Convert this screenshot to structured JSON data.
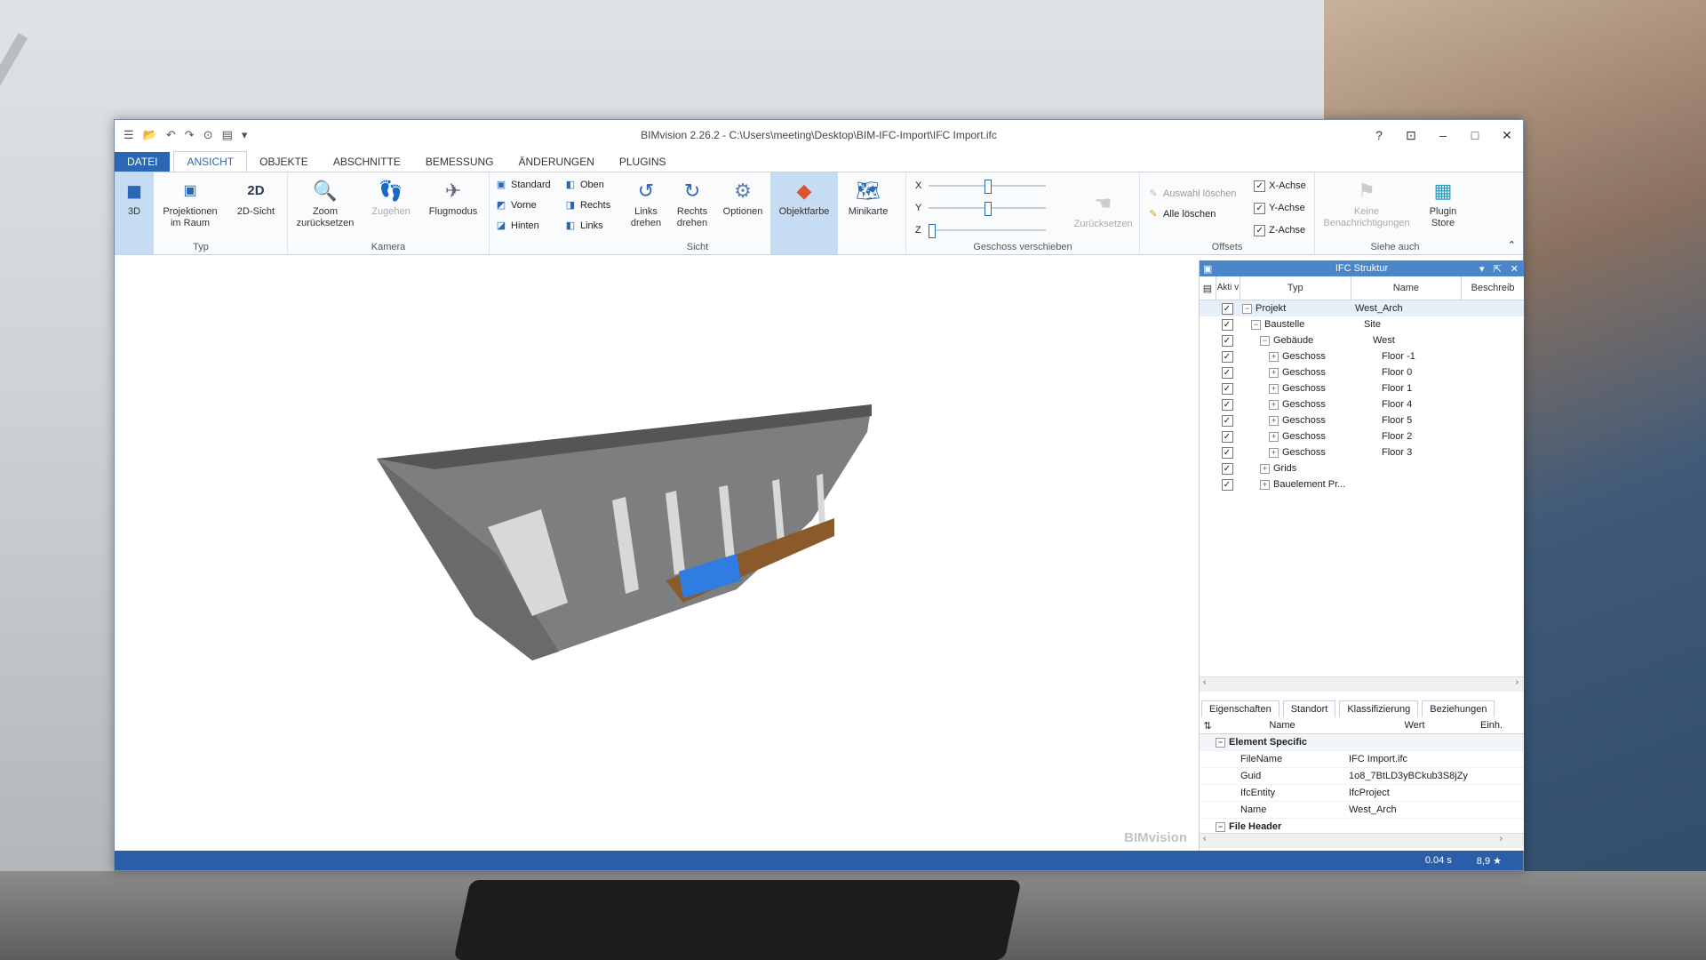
{
  "window": {
    "title": "BIMvision 2.26.2 - C:\\Users\\meeting\\Desktop\\BIM-IFC-Import\\IFC Import.ifc",
    "help": "?",
    "brand": "BIMvision"
  },
  "tabs": [
    "DATEI",
    "ANSICHT",
    "OBJEKTE",
    "ABSCHNITTE",
    "BEMESSUNG",
    "ÄNDERUNGEN",
    "PLUGINS"
  ],
  "ribbon": {
    "typ": {
      "label": "Typ",
      "b3d": "3D",
      "proj1": "Projektionen",
      "proj2": "im Raum",
      "b2d": "2D-Sicht"
    },
    "kamera": {
      "label": "Kamera",
      "zoom1": "Zoom",
      "zoom2": "zurücksetzen",
      "zugehen": "Zugehen",
      "flug": "Flugmodus"
    },
    "sicht": {
      "label": "Sicht",
      "standard": "Standard",
      "vorne": "Vorne",
      "hinten": "Hinten",
      "oben": "Oben",
      "rechts": "Rechts",
      "links": "Links",
      "ld1": "Links",
      "ld2": "drehen",
      "rd1": "Rechts",
      "rd2": "drehen",
      "optionen": "Optionen",
      "farbe": "Objektfarbe",
      "mini": "Minikarte"
    },
    "geschoss": {
      "label": "Geschoss verschieben",
      "x": "X",
      "y": "Y",
      "z": "Z",
      "reset": "Zurücksetzen",
      "x_pos": 0.5,
      "y_pos": 0.5,
      "z_pos": 0.0
    },
    "offsets": {
      "label": "Offsets",
      "auswahl": "Auswahl löschen",
      "alle": "Alle löschen",
      "xa": "X-Achse",
      "ya": "Y-Achse",
      "za": "Z-Achse"
    },
    "siehe": {
      "label": "Siehe auch",
      "keine1": "Keine",
      "keine2": "Benachrichtigungen",
      "store1": "Plugin",
      "store2": "Store"
    }
  },
  "ifc": {
    "title": "IFC Struktur",
    "cols": {
      "akt": "Akti v",
      "typ": "Typ",
      "name": "Name",
      "beschr": "Beschreib"
    },
    "rows": [
      {
        "typ": "Projekt",
        "name": "West_Arch"
      },
      {
        "typ": "Baustelle",
        "name": "Site"
      },
      {
        "typ": "Gebäude",
        "name": "West"
      },
      {
        "typ": "Geschoss",
        "name": "Floor -1"
      },
      {
        "typ": "Geschoss",
        "name": "Floor 0"
      },
      {
        "typ": "Geschoss",
        "name": "Floor 1"
      },
      {
        "typ": "Geschoss",
        "name": "Floor 4"
      },
      {
        "typ": "Geschoss",
        "name": "Floor 5"
      },
      {
        "typ": "Geschoss",
        "name": "Floor 2"
      },
      {
        "typ": "Geschoss",
        "name": "Floor 3"
      },
      {
        "typ": "Grids",
        "name": ""
      },
      {
        "typ": "Bauelement Pr...",
        "name": ""
      }
    ]
  },
  "props": {
    "tabs": [
      "Eigenschaften",
      "Standort",
      "Klassifizierung",
      "Beziehungen"
    ],
    "cols": {
      "name": "Name",
      "wert": "Wert",
      "einh": "Einh."
    },
    "group1": "Element Specific",
    "rows": [
      {
        "name": "FileName",
        "wert": "IFC Import.ifc"
      },
      {
        "name": "Guid",
        "wert": "1o8_7BtLD3yBCkub3S8jZy"
      },
      {
        "name": "IfcEntity",
        "wert": "IfcProject"
      },
      {
        "name": "Name",
        "wert": "West_Arch"
      }
    ],
    "group2": "File Header"
  },
  "status": {
    "time": "0.04 s",
    "fps": "8,9 ★"
  }
}
